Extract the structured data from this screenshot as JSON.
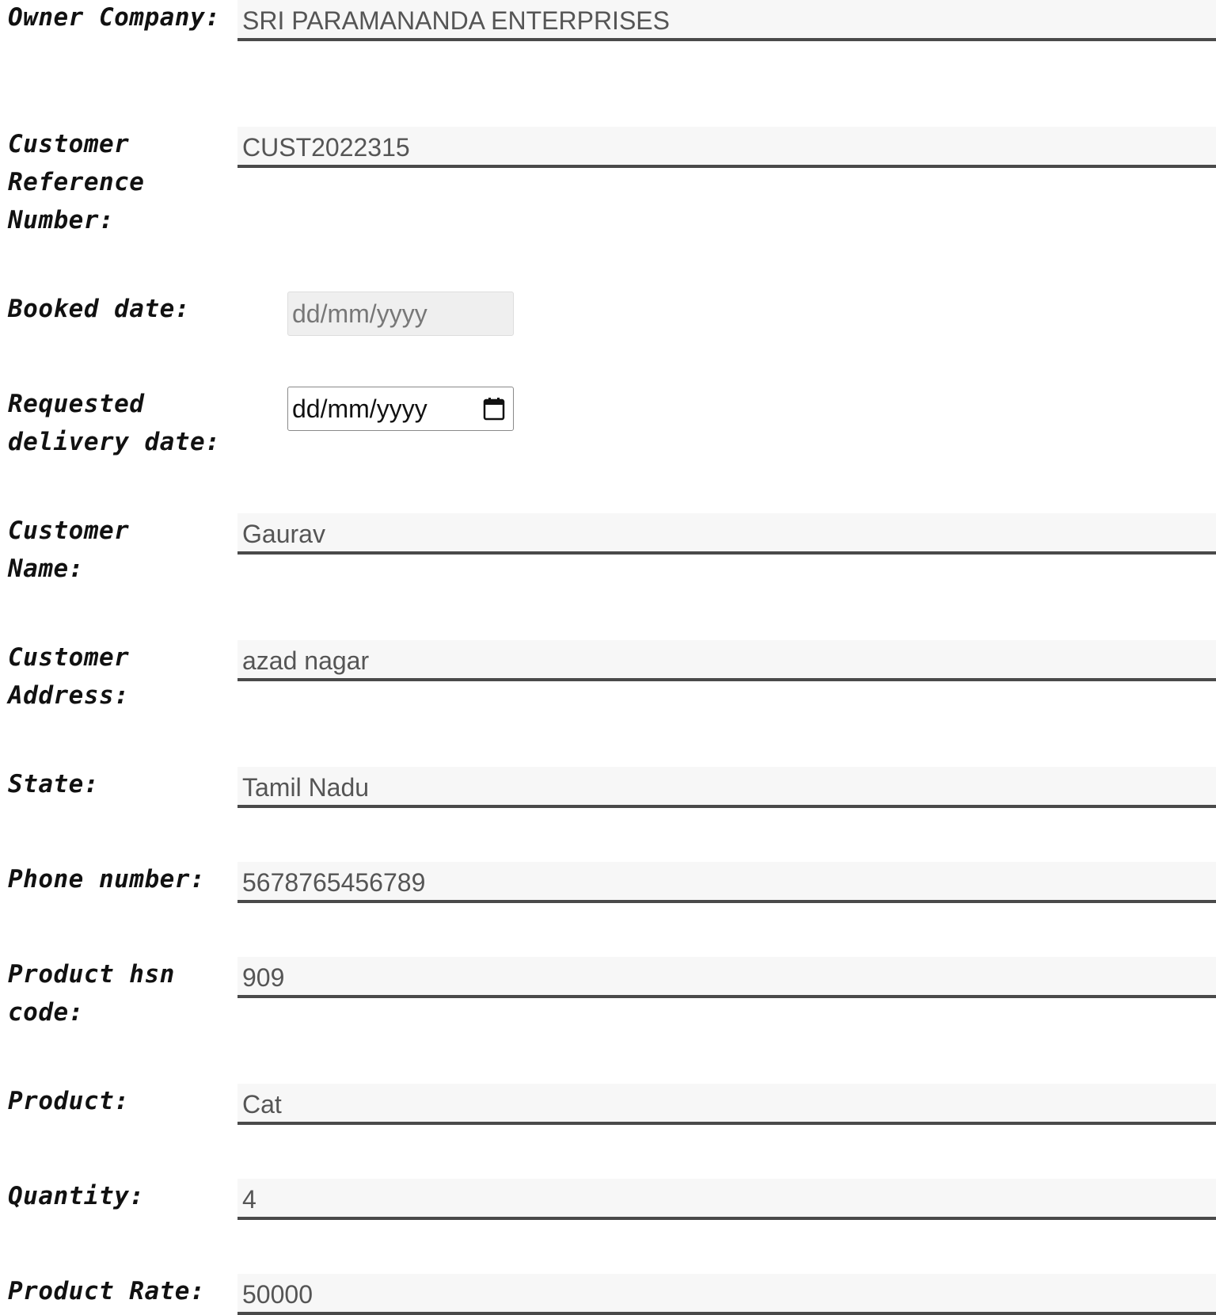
{
  "form": {
    "owner_company": {
      "label": "Owner Company:",
      "value": "SRI PARAMANANDA ENTERPRISES"
    },
    "customer_reference_number": {
      "label": "Customer Reference Number:",
      "value": "CUST2022315"
    },
    "booked_date": {
      "label": "Booked date:",
      "value": "dd/mm/yyyy"
    },
    "requested_delivery_date": {
      "label": "Requested delivery date:",
      "value": "dd/mm/yyyy",
      "icon": "calendar-icon"
    },
    "customer_name": {
      "label": "Customer Name:",
      "value": "Gaurav"
    },
    "customer_address": {
      "label": "Customer Address:",
      "value": "azad nagar"
    },
    "state": {
      "label": "State:",
      "value": "Tamil Nadu"
    },
    "phone_number": {
      "label": "Phone number:",
      "value": "5678765456789"
    },
    "product_hsn_code": {
      "label": "Product hsn code:",
      "value": "909"
    },
    "product": {
      "label": "Product:",
      "value": "Cat"
    },
    "quantity": {
      "label": "Quantity:",
      "value": "4"
    },
    "product_rate": {
      "label": "Product Rate:",
      "value": "50000"
    }
  },
  "colors": {
    "field_background": "#f7f7f7",
    "field_underline": "#4a4a4a",
    "field_text": "#555555",
    "label_text": "#111111"
  }
}
